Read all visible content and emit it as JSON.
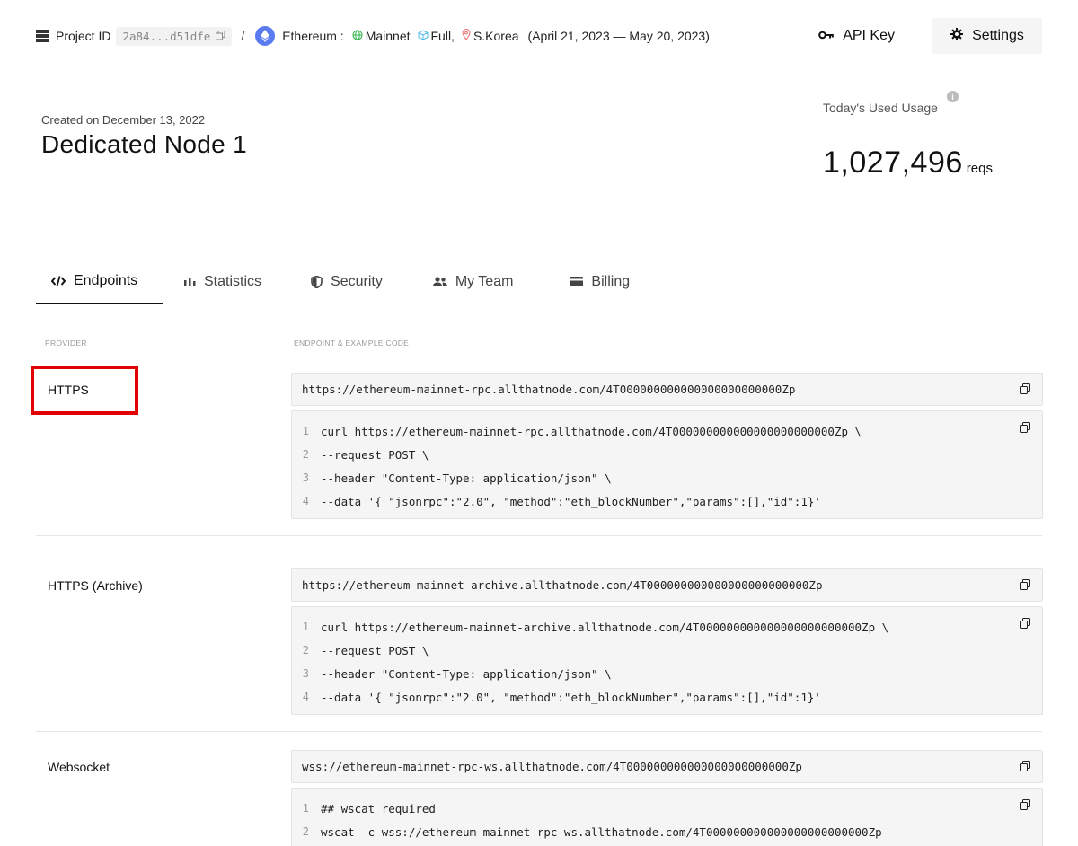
{
  "breadcrumb": {
    "project_label": "Project ID",
    "project_id": "2a84...d51dfe",
    "separator": "/",
    "network": "Ethereum :",
    "net_type": "Mainnet",
    "node_type": "Full,",
    "region": "S.Korea",
    "period": "(April 21, 2023 — May 20, 2023)"
  },
  "actions": {
    "api_key": "API Key",
    "settings": "Settings"
  },
  "node": {
    "created": "Created on December 13, 2022",
    "title": "Dedicated Node 1"
  },
  "usage": {
    "label": "Today's Used Usage",
    "value": "1,027,496",
    "unit": "reqs"
  },
  "tabs": [
    {
      "label": "Endpoints"
    },
    {
      "label": "Statistics"
    },
    {
      "label": "Security"
    },
    {
      "label": "My Team"
    },
    {
      "label": "Billing"
    }
  ],
  "columns": {
    "provider": "PROVIDER",
    "endpoint": "ENDPOINT & EXAMPLE CODE"
  },
  "endpoints": [
    {
      "provider": "HTTPS",
      "url": "https://ethereum-mainnet-rpc.allthatnode.com/4T000000000000000000000000Zp",
      "code": [
        "curl https://ethereum-mainnet-rpc.allthatnode.com/4T000000000000000000000000Zp \\",
        "--request POST \\",
        "--header \"Content-Type: application/json\" \\",
        "--data '{ \"jsonrpc\":\"2.0\", \"method\":\"eth_blockNumber\",\"params\":[],\"id\":1}'"
      ]
    },
    {
      "provider": "HTTPS (Archive)",
      "url": "https://ethereum-mainnet-archive.allthatnode.com/4T000000000000000000000000Zp",
      "code": [
        "curl https://ethereum-mainnet-archive.allthatnode.com/4T000000000000000000000000Zp \\",
        "--request POST \\",
        "--header \"Content-Type: application/json\" \\",
        "--data '{ \"jsonrpc\":\"2.0\", \"method\":\"eth_blockNumber\",\"params\":[],\"id\":1}'"
      ]
    },
    {
      "provider": "Websocket",
      "url": "wss://ethereum-mainnet-rpc-ws.allthatnode.com/4T000000000000000000000000Zp",
      "code": [
        "## wscat required",
        "wscat -c wss://ethereum-mainnet-rpc-ws.allthatnode.com/4T000000000000000000000000Zp"
      ]
    }
  ],
  "line_numbers": [
    "1",
    "2",
    "3",
    "4"
  ],
  "colors": {
    "accent_highlight": "#e30000",
    "eth_blue": "#5b7cf0",
    "code_bg": "#f5f5f5"
  }
}
